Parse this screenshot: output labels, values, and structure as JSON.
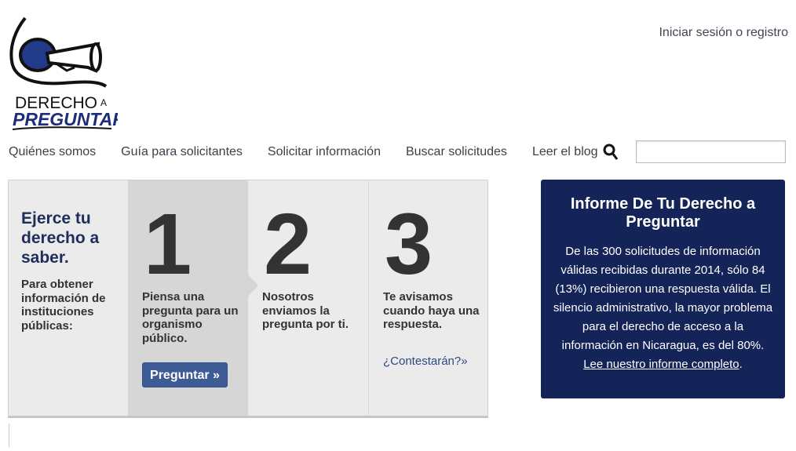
{
  "logo": {
    "line1": "DERECHO",
    "line1_small": "A",
    "line2": "PREGUNTAR"
  },
  "header": {
    "login": "Iniciar sesión o registro"
  },
  "nav": {
    "items": [
      "Quiénes somos",
      "Guía para solicitantes",
      "Solicitar información",
      "Buscar solicitudes",
      "Leer el blog"
    ],
    "search_placeholder": ""
  },
  "intro": {
    "title": "Ejerce tu derecho a saber.",
    "text": "Para obtener información de instituciones públicas:"
  },
  "steps": [
    {
      "number": "1",
      "text": "Piensa una pregunta para un organismo público.",
      "button": "Preguntar »"
    },
    {
      "number": "2",
      "text": "Nosotros enviamos la pregunta por ti."
    },
    {
      "number": "3",
      "text": "Te avisamos cuando haya una respuesta.",
      "link": "¿Contestarán?»"
    }
  ],
  "report": {
    "title": "Informe De Tu Derecho a Preguntar",
    "body": "De las 300 solicitudes de información válidas recibidas durante 2014, sólo 84 (13%) recibieron una respuesta válida. El silencio administrativo, la mayor problema para el derecho de acceso a la información en Nicaragua, es del 80%.",
    "link": "Lee nuestro informe completo",
    "period": "."
  },
  "colors": {
    "brand_navy": "#142458",
    "button_blue": "#3d5b95",
    "heading_navy": "#1d2d5c"
  }
}
